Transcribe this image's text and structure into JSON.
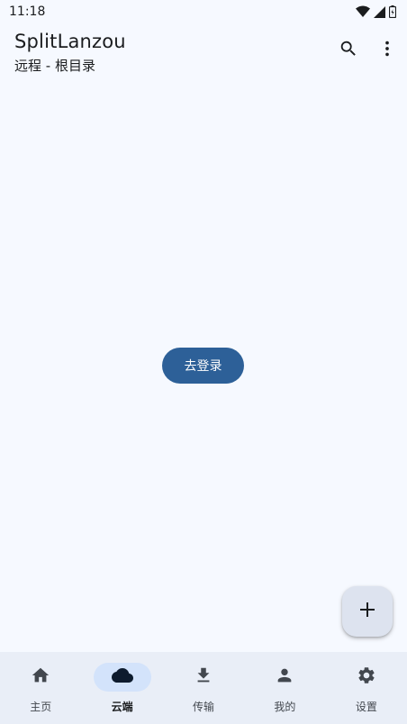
{
  "status_bar": {
    "time": "11:18",
    "icons": [
      "wifi-icon",
      "cell-signal-icon",
      "battery-icon"
    ]
  },
  "app_bar": {
    "title": "SplitLanzou",
    "subtitle": "远程 - 根目录",
    "actions": [
      "search-icon",
      "more-vert-icon"
    ]
  },
  "main": {
    "login_button_label": "去登录"
  },
  "fab": {
    "icon": "add-icon"
  },
  "bottom_nav": {
    "items": [
      {
        "label": "主页",
        "icon": "home-icon",
        "active": false
      },
      {
        "label": "云端",
        "icon": "cloud-icon",
        "active": true
      },
      {
        "label": "传输",
        "icon": "download-icon",
        "active": false
      },
      {
        "label": "我的",
        "icon": "person-icon",
        "active": false
      },
      {
        "label": "设置",
        "icon": "settings-icon",
        "active": false
      }
    ]
  },
  "colors": {
    "background": "#f6f9ff",
    "primary": "#2d6098",
    "nav_background": "#e9eef7",
    "nav_active_indicator": "#d3e3fb",
    "fab_background": "#dde3ef"
  }
}
